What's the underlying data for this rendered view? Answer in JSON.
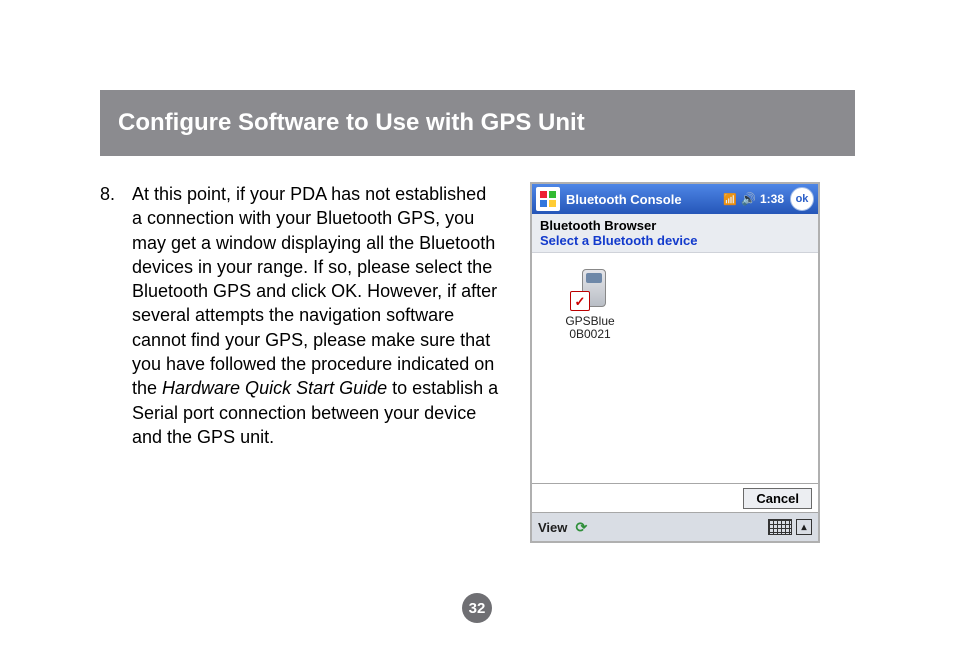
{
  "title": "Configure Software to Use with GPS Unit",
  "step": {
    "number": "8.",
    "text_before": "At this point, if your PDA has not established a connection with your Bluetooth GPS, you may get a window displaying all the Bluetooth devices in your range.  If so, please select the Bluetooth GPS and click OK.  However, if after several attempts the navigation software cannot find your GPS, please make sure that you have followed the procedure indicated on the ",
    "text_italic": "Hardware Quick Start Guide",
    "text_after": " to establish a Serial port connection between your device and the GPS unit."
  },
  "pda": {
    "top_title": "Bluetooth Console",
    "time": "1:38",
    "ok": "ok",
    "sub1": "Bluetooth Browser",
    "sub2": "Select a Bluetooth device",
    "device": {
      "line1": "GPSBlue",
      "line2": "0B0021"
    },
    "cancel": "Cancel",
    "bottom_view": "View"
  },
  "page_number": "32"
}
